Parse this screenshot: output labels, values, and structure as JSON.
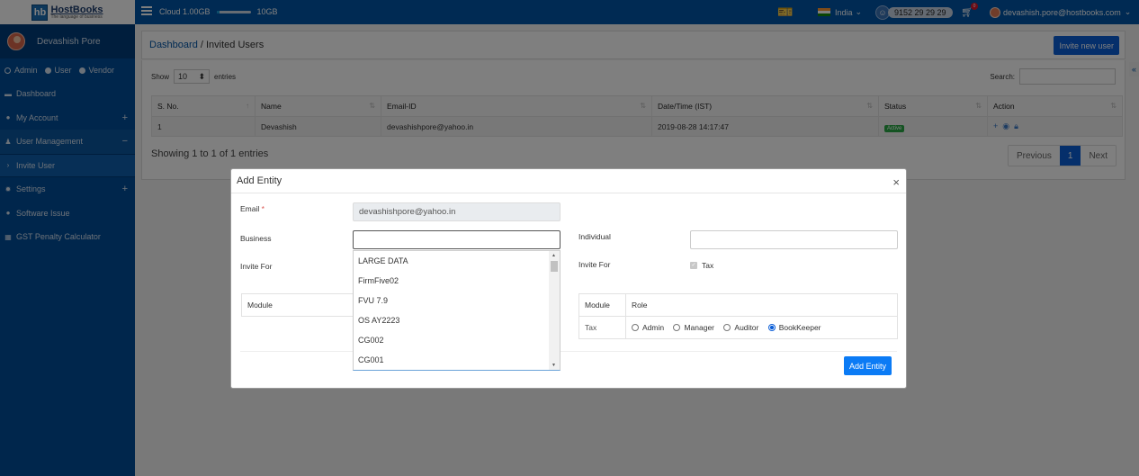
{
  "brand": {
    "logo_mark": "hb",
    "name": "HostBooks",
    "tagline": "The language of business"
  },
  "topbar": {
    "cloud_label": "Cloud 1.00GB",
    "cloud_limit": "10GB",
    "cloud_used_fraction": 0.1,
    "country": "India",
    "phone": "9152 29 29 29",
    "cart_count": "0",
    "user_email": "devashish.pore@hostbooks.com"
  },
  "sidebar": {
    "profile_name": "Devashish Pore",
    "roles": [
      {
        "label": "Admin",
        "selected": false
      },
      {
        "label": "User",
        "selected": true
      },
      {
        "label": "Vendor",
        "selected": true
      }
    ],
    "items": [
      {
        "label": "Dashboard",
        "icon": "dashboard-icon"
      },
      {
        "label": "My Account",
        "icon": "user-circle-icon",
        "toggle": "+"
      },
      {
        "label": "User Management",
        "icon": "users-icon",
        "toggle": "−"
      },
      {
        "label": "Invite User",
        "icon": "chevron-right-icon"
      },
      {
        "label": "Settings",
        "icon": "gear-icon",
        "toggle": "+"
      },
      {
        "label": "Software Issue",
        "icon": "info-icon"
      },
      {
        "label": "GST Penalty Calculator",
        "icon": "calculator-icon"
      }
    ]
  },
  "breadcrumb": {
    "home": "Dashboard",
    "separator": " / ",
    "current": "Invited Users"
  },
  "invite_button": "Invite new user",
  "table_controls": {
    "show_label": "Show",
    "entries_value": "10",
    "entries_label": "entries",
    "search_label": "Search:",
    "search_value": ""
  },
  "table": {
    "headers": [
      "S. No.",
      "Name",
      "Email-ID",
      "Date/Time (IST)",
      "Status",
      "Action"
    ],
    "rows": [
      {
        "sno": "1",
        "name": "Devashish",
        "email": "devashishpore@yahoo.in",
        "datetime": "2019-08-28 14:17:47",
        "status": "Active"
      }
    ],
    "info": "Showing 1 to 1 of 1 entries",
    "pagination": {
      "prev": "Previous",
      "current": "1",
      "next": "Next"
    }
  },
  "modal": {
    "title": "Add Entity",
    "close": "×",
    "email_label": "Email",
    "required_mark": "*",
    "email_value": "devashishpore@yahoo.in",
    "business_label": "Business",
    "business_value": "",
    "business_options": [
      "LARGE DATA",
      "FirmFive02",
      "FVU 7.9",
      "OS AY2223",
      "CG002",
      "CG001"
    ],
    "invite_for_label": "Invite For",
    "individual_label": "Individual",
    "individual_value": "",
    "invite_for_right_label": "Invite For",
    "invite_for_option": "Tax",
    "left_table_header": "Module",
    "right_table": {
      "headers": [
        "Module",
        "Role"
      ],
      "module": "Tax",
      "roles": [
        {
          "label": "Admin",
          "selected": false
        },
        {
          "label": "Manager",
          "selected": false
        },
        {
          "label": "Auditor",
          "selected": false
        },
        {
          "label": "BookKeeper",
          "selected": true
        }
      ]
    },
    "submit": "Add Entity"
  }
}
